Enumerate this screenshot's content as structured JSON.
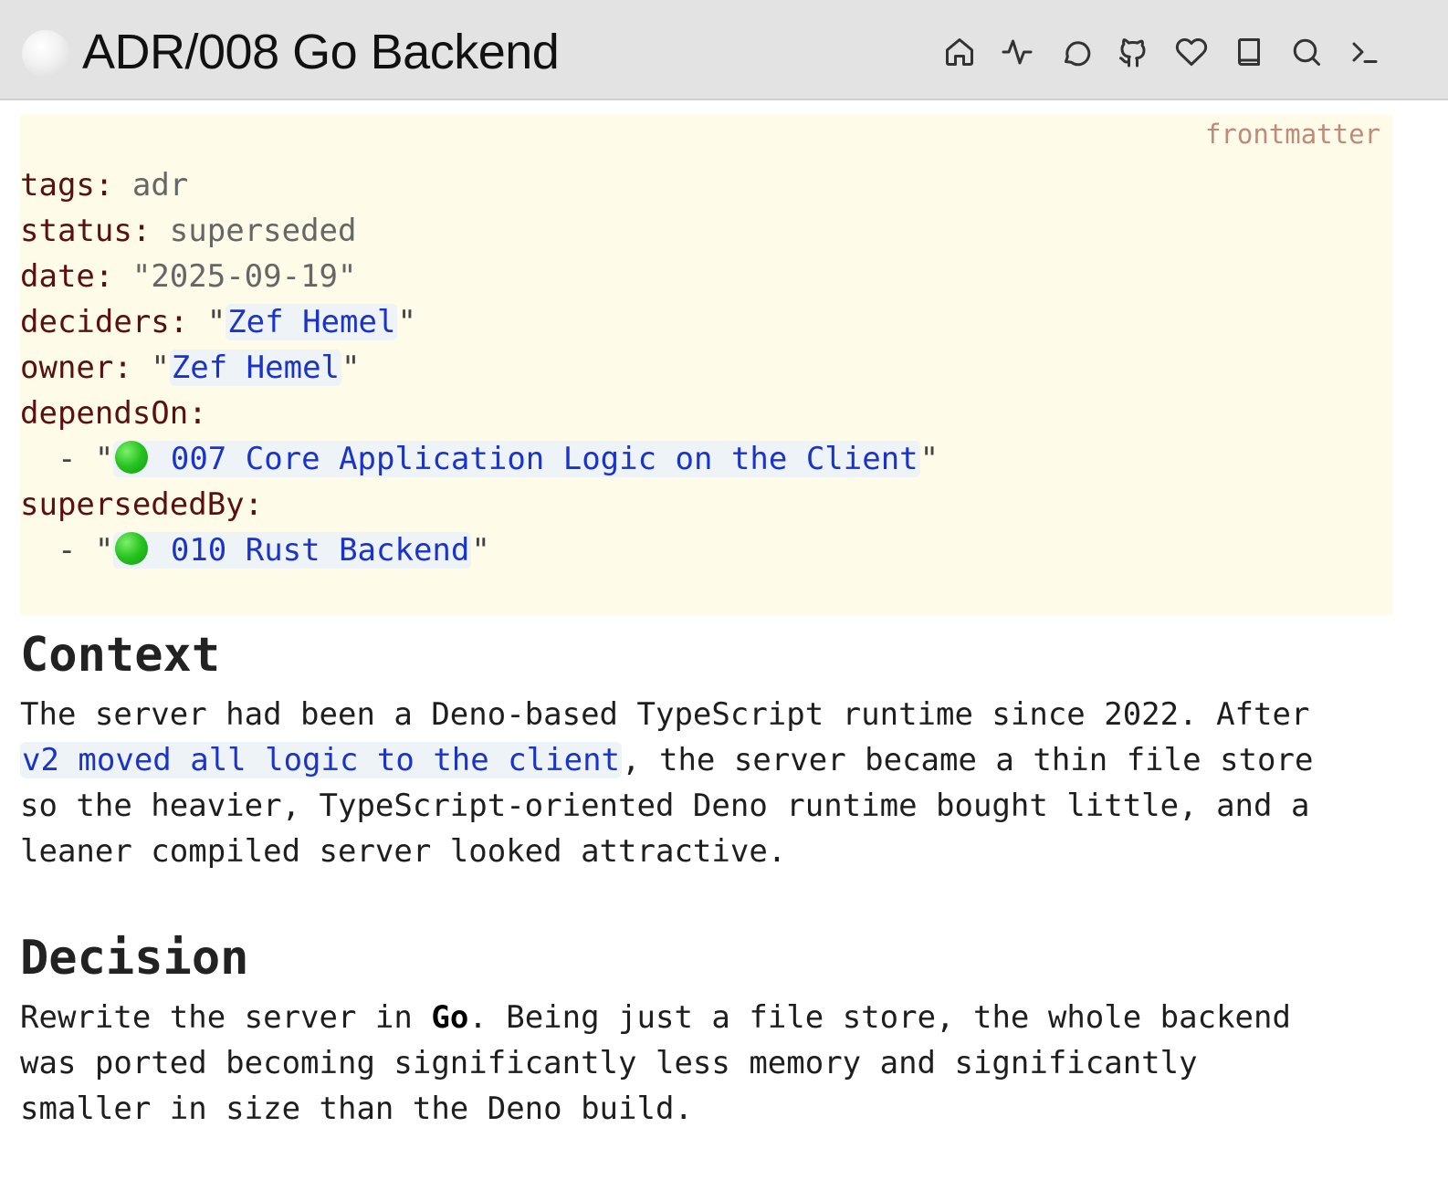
{
  "title": "ADR/008 Go Backend",
  "actions": [
    {
      "icon": "home-icon",
      "label": "Home"
    },
    {
      "icon": "activity-icon",
      "label": "Activity"
    },
    {
      "icon": "chat-icon",
      "label": "Chat"
    },
    {
      "icon": "github-icon",
      "label": "GitHub"
    },
    {
      "icon": "heart-icon",
      "label": "Favorites"
    },
    {
      "icon": "book-icon",
      "label": "Library"
    },
    {
      "icon": "search-icon",
      "label": "Search"
    },
    {
      "icon": "terminal-icon",
      "label": "Terminal"
    }
  ],
  "frontmatter": {
    "label": "frontmatter",
    "tags_key": "tags:",
    "tags_value": "adr",
    "status_key": "status:",
    "status_value": "superseded",
    "date_key": "date:",
    "date_value": "\"2025-09-19\"",
    "deciders_key": "deciders:",
    "deciders_value": "Zef Hemel",
    "owner_key": "owner:",
    "owner_value": "Zef Hemel",
    "dependsOn_key": "dependsOn:",
    "dependsOn_item": "007 Core Application Logic on the Client",
    "supersededBy_key": "supersededBy:",
    "supersededBy_item": "010 Rust Backend",
    "quote": "\"",
    "list_dash": "  - "
  },
  "context": {
    "heading": "Context",
    "line1": "The server had been a Deno-based TypeScript runtime since 2022. After",
    "link": "v2 moved all logic to the client",
    "line2_rest": ", the server became a thin file store",
    "line3": "so the heavier, TypeScript-oriented Deno runtime bought little, and a",
    "line4": "leaner compiled server looked attractive."
  },
  "decision": {
    "heading": "Decision",
    "line1_pre": "Rewrite the server in ",
    "line1_bold": "Go",
    "line1_post": ". Being just a file store, the whole backend",
    "line2": "was ported becoming significantly less memory and significantly",
    "line3": "smaller in size than the Deno build."
  },
  "colors": {
    "topbar": "#e3e3e3",
    "frontmatter_bg": "#fefbe8",
    "key": "#5a1010",
    "link": "#1a33c8",
    "status_dot": "#26c21f"
  }
}
